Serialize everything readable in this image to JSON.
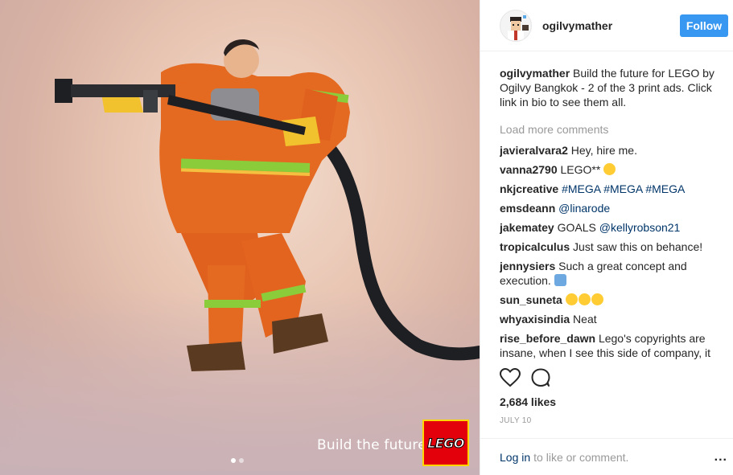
{
  "post": {
    "tagline": "Build the future.",
    "logo_text": "LEGO",
    "carousel": {
      "count": 2,
      "active": 1
    }
  },
  "header": {
    "username": "ogilvymather",
    "follow_label": "Follow"
  },
  "caption": {
    "username": "ogilvymather",
    "text": "Build the future for LEGO by Ogilvy Bangkok - 2 of the 3 print ads. Click link in bio to see them all."
  },
  "load_more": "Load more comments",
  "comments": [
    {
      "user": "javieralvara2",
      "text": "Hey, hire me."
    },
    {
      "user": "vanna2790",
      "text": "LEGO**",
      "emoji": [
        "smiling-face"
      ]
    },
    {
      "user": "nkjcreative",
      "links": [
        "#MEGA",
        "#MEGA",
        "#MEGA"
      ]
    },
    {
      "user": "emsdeann",
      "links": [
        "@linarode"
      ]
    },
    {
      "user": "jakematey",
      "text": "GOALS",
      "links": [
        "@kellyrobson21"
      ]
    },
    {
      "user": "tropicalculus",
      "text": "Just saw this on behance!"
    },
    {
      "user": "jennysiers",
      "text": "Such a great concept and execution.",
      "emoji": [
        "raised-hands"
      ]
    },
    {
      "user": "sun_suneta",
      "emoji": [
        "heart-eyes",
        "heart-eyes",
        "heart-eyes"
      ]
    },
    {
      "user": "whyaxisindia",
      "text": "Neat"
    },
    {
      "user": "rise_before_dawn",
      "text": "Lego's copyrights are insane, when I see this side of company, it makes me cringe"
    }
  ],
  "actions": {
    "like_icon": "heart-icon",
    "comment_icon": "comment-icon"
  },
  "likes": "2,684 likes",
  "date": "JULY 10",
  "footer": {
    "login_label": "Log in",
    "rest_text": "to like or comment.",
    "more_label": "..."
  },
  "colors": {
    "accent": "#3897f0",
    "link": "#003569",
    "muted": "#999999",
    "lego_red": "#e3000b"
  }
}
